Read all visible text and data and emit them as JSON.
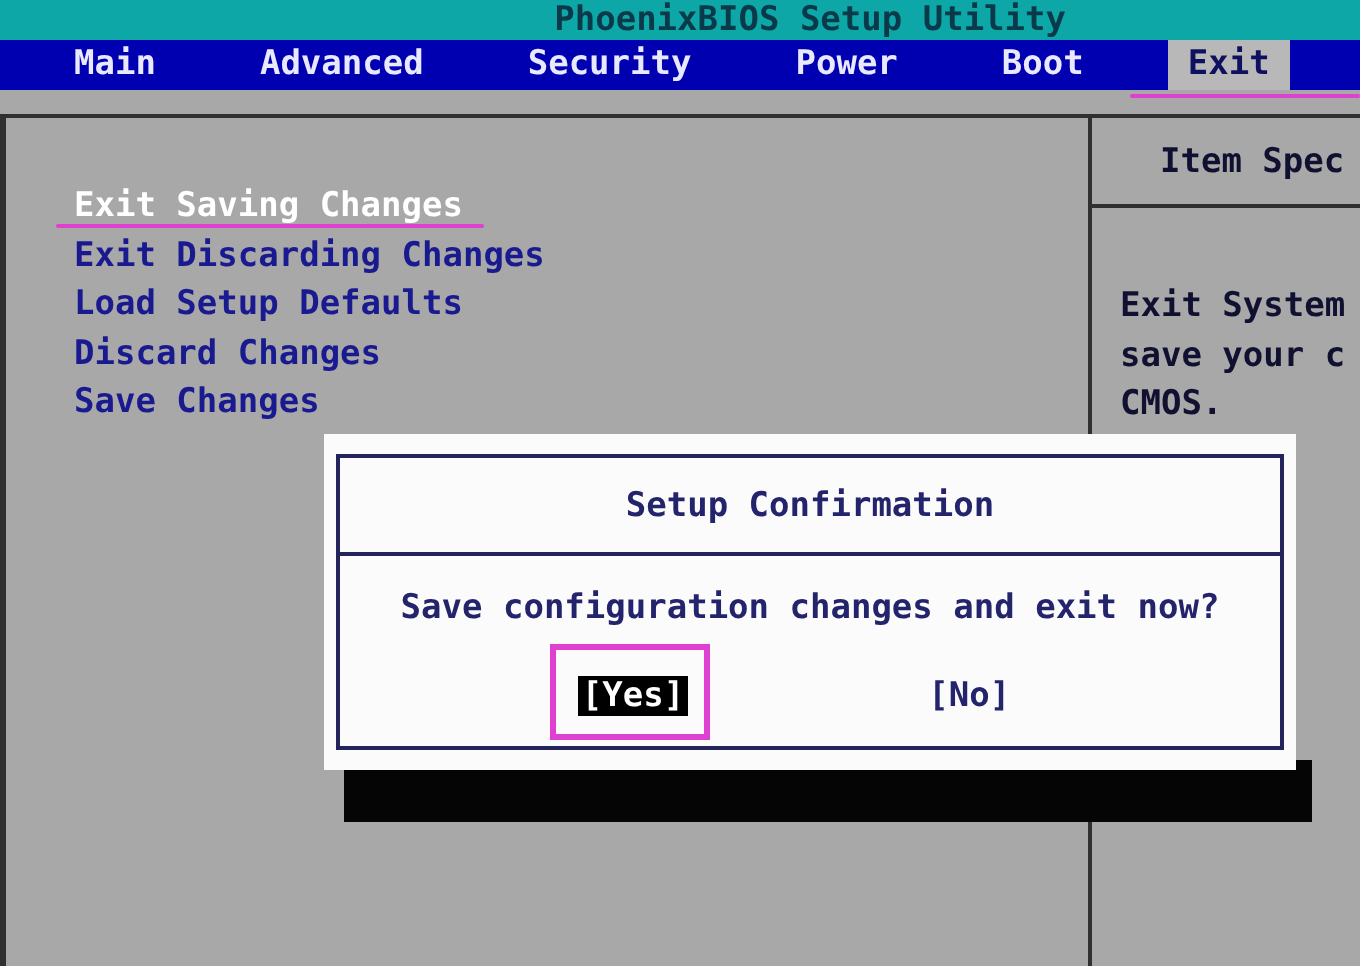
{
  "title": "PhoenixBIOS Setup Utility",
  "tabs": [
    {
      "label": "Main",
      "selected": false
    },
    {
      "label": "Advanced",
      "selected": false
    },
    {
      "label": "Security",
      "selected": false
    },
    {
      "label": "Power",
      "selected": false
    },
    {
      "label": "Boot",
      "selected": false
    },
    {
      "label": "Exit",
      "selected": true
    }
  ],
  "menu_items": [
    {
      "label": "Exit Saving Changes",
      "selected": true
    },
    {
      "label": "Exit Discarding Changes",
      "selected": false
    },
    {
      "label": "Load Setup Defaults",
      "selected": false
    },
    {
      "label": "Discard Changes",
      "selected": false
    },
    {
      "label": "Save Changes",
      "selected": false
    }
  ],
  "help_panel": {
    "title": "Item Spec",
    "lines": [
      "Exit System",
      "save your c",
      "CMOS."
    ]
  },
  "dialog": {
    "title": "Setup Confirmation",
    "message": "Save configuration changes and exit now?",
    "buttons": [
      {
        "label": "[Yes]",
        "selected": true
      },
      {
        "label": "[No]",
        "selected": false
      }
    ]
  }
}
